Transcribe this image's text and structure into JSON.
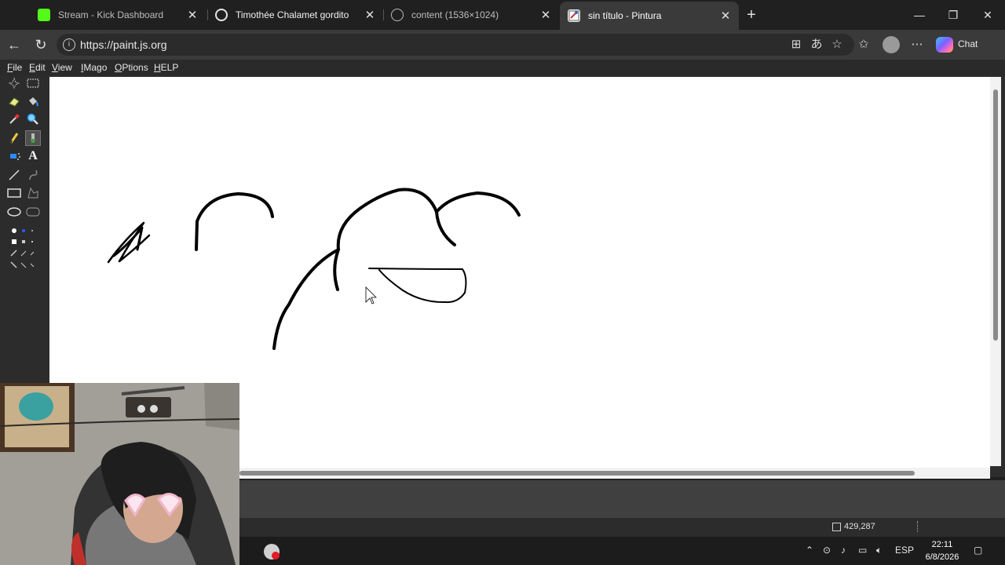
{
  "browser": {
    "tabs": [
      {
        "title": "Stream - Kick Dashboard",
        "favicon": "kick-logo-icon",
        "active": false
      },
      {
        "title": "Timothée Chalamet gordito",
        "favicon": "chatgpt-logo-icon",
        "active": false
      },
      {
        "title": "content (1536×1024)",
        "favicon": "globe-icon",
        "active": false
      },
      {
        "title": "sin título - Pintura",
        "favicon": "paint-icon",
        "active": true
      }
    ],
    "address": {
      "url": "https://paint.js.org"
    },
    "chat_label": "Chat"
  },
  "paint": {
    "menu": [
      {
        "label": "File",
        "accel": "F",
        "rest": "ile"
      },
      {
        "label": "Edit",
        "accel": "E",
        "rest": "dit"
      },
      {
        "label": "View",
        "accel": "V",
        "rest": "iew"
      },
      {
        "label": "IMago",
        "accel": "I",
        "rest": "Mago"
      },
      {
        "label": "OPtions",
        "accel": "O",
        "rest": "Ptions"
      },
      {
        "label": "HELP",
        "accel": "H",
        "rest": "ELP"
      }
    ],
    "tools": [
      "free-select-icon",
      "rect-select-icon",
      "eraser-icon",
      "fill-bucket-icon",
      "color-picker-icon",
      "magnifier-icon",
      "pencil-icon",
      "brush-icon",
      "airbrush-icon",
      "text-icon",
      "line-icon",
      "curve-icon",
      "rectangle-icon",
      "polygon-icon",
      "ellipse-icon",
      "rounded-rect-icon"
    ],
    "selected_tool": "brush-icon",
    "status": {
      "cursor_position": "429,287"
    },
    "colors": {
      "canvas": "#ffffff",
      "stroke": "#000000",
      "chrome": "#2c2c2c"
    }
  },
  "taskbar": {
    "language": "ESP",
    "time": "22:11",
    "date": "6/8/2026"
  }
}
